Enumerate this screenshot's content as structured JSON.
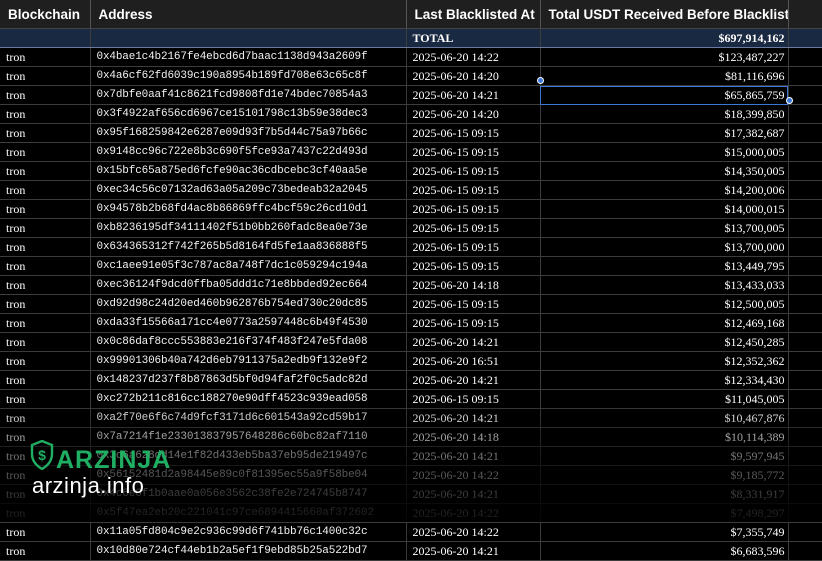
{
  "columns": [
    "Blockchain",
    "Address",
    "Last Blacklisted At",
    "Total USDT Received Before Blacklist",
    ""
  ],
  "total": {
    "label": "TOTAL",
    "amount": "$697,914,162"
  },
  "rows": [
    {
      "chain": "tron",
      "address": "0x4bae1c4b2167fe4ebcd6d7baac1138d943a2609f",
      "date": "2025-06-20 14:22",
      "amount": "$123,487,227"
    },
    {
      "chain": "tron",
      "address": "0x4a6cf62fd6039c190a8954b189fd708e63c65c8f",
      "date": "2025-06-20 14:20",
      "amount": "$81,116,696"
    },
    {
      "chain": "tron",
      "address": "0x7dbfe0aaf41c8621fcd9808fd1e74bdec70854a3",
      "date": "2025-06-20 14:21",
      "amount": "$65,865,759"
    },
    {
      "chain": "tron",
      "address": "0x3f4922af656cd6967ce15101798c13b59e38dec3",
      "date": "2025-06-20 14:20",
      "amount": "$18,399,850"
    },
    {
      "chain": "tron",
      "address": "0x95f168259842e6287e09d93f7b5d44c75a97b66c",
      "date": "2025-06-15 09:15",
      "amount": "$17,382,687"
    },
    {
      "chain": "tron",
      "address": "0x9148cc96c722e8b3c690f5fce93a7437c22d493d",
      "date": "2025-06-15 09:15",
      "amount": "$15,000,005"
    },
    {
      "chain": "tron",
      "address": "0x15bfc65a875ed6fcfe90ac36cdbcebc3cf40aa5e",
      "date": "2025-06-15 09:15",
      "amount": "$14,350,005"
    },
    {
      "chain": "tron",
      "address": "0xec34c56c07132ad63a05a209c73bedeab32a2045",
      "date": "2025-06-15 09:15",
      "amount": "$14,200,006"
    },
    {
      "chain": "tron",
      "address": "0x94578b2b68fd4ac8b86869ffc4bcf59c26cd10d1",
      "date": "2025-06-15 09:15",
      "amount": "$14,000,015"
    },
    {
      "chain": "tron",
      "address": "0xb8236195df34111402f51b0bb260fadc8ea0e73e",
      "date": "2025-06-15 09:15",
      "amount": "$13,700,005"
    },
    {
      "chain": "tron",
      "address": "0x634365312f742f265b5d8164fd5fe1aa836888f5",
      "date": "2025-06-15 09:15",
      "amount": "$13,700,000"
    },
    {
      "chain": "tron",
      "address": "0xc1aee91e05f3c787ac8a748f7dc1c059294c194a",
      "date": "2025-06-15 09:15",
      "amount": "$13,449,795"
    },
    {
      "chain": "tron",
      "address": "0xec36124f9dcd0ffba05ddd1c71e8bbded92ec664",
      "date": "2025-06-20 14:18",
      "amount": "$13,433,033"
    },
    {
      "chain": "tron",
      "address": "0xd92d98c24d20ed460b962876b754ed730c20dc85",
      "date": "2025-06-15 09:15",
      "amount": "$12,500,005"
    },
    {
      "chain": "tron",
      "address": "0xda33f15566a171cc4e0773a2597448c6b49f4530",
      "date": "2025-06-15 09:15",
      "amount": "$12,469,168"
    },
    {
      "chain": "tron",
      "address": "0x0c86daf8ccc553883e216f374f483f247e5fda08",
      "date": "2025-06-20 14:21",
      "amount": "$12,450,285"
    },
    {
      "chain": "tron",
      "address": "0x99901306b40a742d6eb7911375a2edb9f132e9f2",
      "date": "2025-06-20 16:51",
      "amount": "$12,352,362"
    },
    {
      "chain": "tron",
      "address": "0x148237d237f8b87863d5bf0d94faf2f0c5adc82d",
      "date": "2025-06-20 14:21",
      "amount": "$12,334,430"
    },
    {
      "chain": "tron",
      "address": "0xc272b211c816cc188270e90dff4523c939ead058",
      "date": "2025-06-15 09:15",
      "amount": "$11,045,005"
    },
    {
      "chain": "tron",
      "address": "0xa2f70e6f6c74d9fcf3171d6c601543a92cd59b17",
      "date": "2025-06-20 14:21",
      "amount": "$10,467,876"
    },
    {
      "chain": "tron",
      "address": "0x7a7214f1e233013837957648286c60bc82af7110",
      "date": "2025-06-20 14:18",
      "amount": "$10,114,389"
    },
    {
      "chain": "tron",
      "address": "0x3c6a628dd14e1f82d433eb5ba37eb95de219497c",
      "date": "2025-06-20 14:21",
      "amount": "$9,597,945"
    },
    {
      "chain": "tron",
      "address": "0x56152481d2a98445e89c0f81395ec55a9f58be04",
      "date": "2025-06-20 14:22",
      "amount": "$9,185,772"
    },
    {
      "chain": "tron",
      "address": "0x4c6e0f1b0aae0a056e3562c38fe2e724745b8747",
      "date": "2025-06-20 14:21",
      "amount": "$8,331,917"
    },
    {
      "chain": "tron",
      "address": "0x5f47ea2eb20c221041c97ce6894415660af372602",
      "date": "2025-06-20 14:22",
      "amount": "$7,498,297"
    },
    {
      "chain": "tron",
      "address": "0x11a05fd804c9e2c936c99d6f741bb76c1400c32c",
      "date": "2025-06-20 14:22",
      "amount": "$7,355,749"
    },
    {
      "chain": "tron",
      "address": "0x10d80e724cf44eb1b2a5ef1f9ebd85b25a522bd7",
      "date": "2025-06-20 14:21",
      "amount": "$6,683,596"
    }
  ],
  "watermark": {
    "brand": "ARZINJA",
    "url": "arzinja.info",
    "icon": "dollar-shield-icon",
    "color": "#1fae62"
  },
  "colors": {
    "total_row": "#1a2942",
    "selection": "#3b78d8",
    "header": "#1f1f1f"
  }
}
